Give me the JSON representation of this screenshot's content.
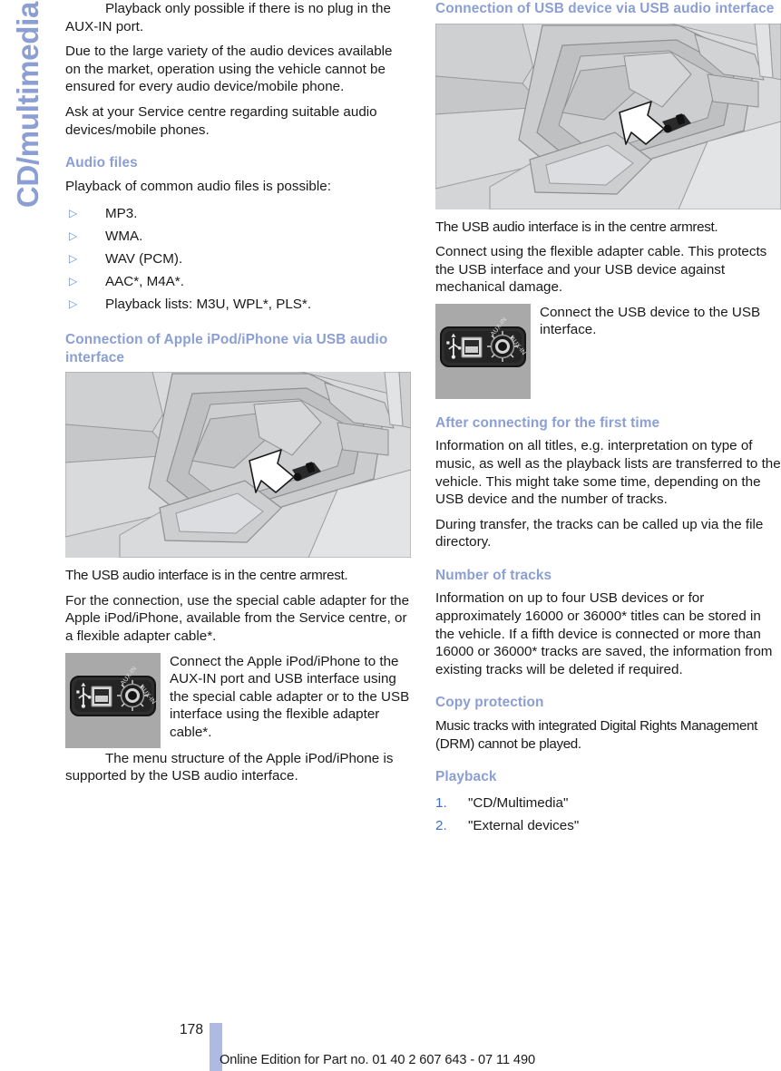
{
  "chapter": {
    "tab_label": "CD/multimedia"
  },
  "left_column": {
    "intro_bullet_continuation": "Playback only possible if there is no plug in the AUX-IN port.",
    "paragraph_variety": "Due to the large variety of the audio devices available on the market, operation using the vehicle cannot be ensured for every audio device/mobile phone.",
    "paragraph_service": "Ask at your Service centre regarding suitable audio devices/mobile phones.",
    "audio_files": {
      "heading": "Audio files",
      "intro": "Playback of common audio files is possible:",
      "bullet_marker": "▷",
      "items": [
        "MP3.",
        "WMA.",
        "WAV (PCM).",
        "AAC*, M4A*.",
        "Playback lists: M3U, WPL*, PLS*."
      ]
    },
    "ipod_section": {
      "heading": "Connection of Apple iPod/iPhone via USB audio interface",
      "figure_name": "centre-armrest-usb-port-illustration",
      "caption_after_figure": "The USB audio interface is in the centre armrest.",
      "paragraph_cable": "For the connection, use the special cable adapter for the Apple iPod/iPhone, available from the Service centre, or a flexible adapter cable*.",
      "port_instruction": "Connect the Apple iPod/iPhone to the AUX-IN port and USB interface using the special cable adapter or to the USB interface using the flexible adapter cable*.",
      "paragraph_menu": "The menu structure of the Apple iPod/iPhone is supported by the USB audio interface."
    }
  },
  "right_column": {
    "usb_section": {
      "heading": "Connection of USB device via USB audio interface",
      "figure_name": "centre-armrest-usb-port-illustration",
      "caption_after_figure": "The USB audio interface is in the centre armrest.",
      "paragraph_flexible": "Connect using the flexible adapter cable. This protects the USB interface and your USB device against mechanical damage.",
      "port_instruction": "Connect the USB device to the USB interface."
    },
    "first_time": {
      "heading": "After connecting for the first time",
      "paragraph_info": "Information on all titles, e.g. interpretation on type of music, as well as the playback lists are transferred to the vehicle. This might take some time, depending on the USB device and the number of tracks.",
      "paragraph_transfer": "During transfer, the tracks can be called up via the file directory."
    },
    "number_of_tracks": {
      "heading": "Number of tracks",
      "paragraph": "Information on up to four USB devices or for approximately 16000 or 36000* titles can be stored in the vehicle. If a fifth device is connected or more than 16000 or 36000* tracks are saved, the information from existing tracks will be deleted if required."
    },
    "copy_protection": {
      "heading": "Copy protection",
      "paragraph": "Music tracks with integrated Digital Rights Management (DRM) cannot be played."
    },
    "playback": {
      "heading": "Playback",
      "steps": [
        {
          "number": "1.",
          "label": "\"CD/Multimedia\""
        },
        {
          "number": "2.",
          "label": "\"External devices\""
        }
      ]
    }
  },
  "footer": {
    "page_number": "178",
    "edition_text": "Online Edition for Part no. 01 40 2 607 643 - 07 11 490"
  },
  "colors": {
    "heading_blue": "#8b9fd4",
    "bullet_blue": "#6f8fd0",
    "number_blue": "#3c6fc4",
    "footer_bar_blue": "#aebae2",
    "body_text": "#1a1a1a"
  }
}
